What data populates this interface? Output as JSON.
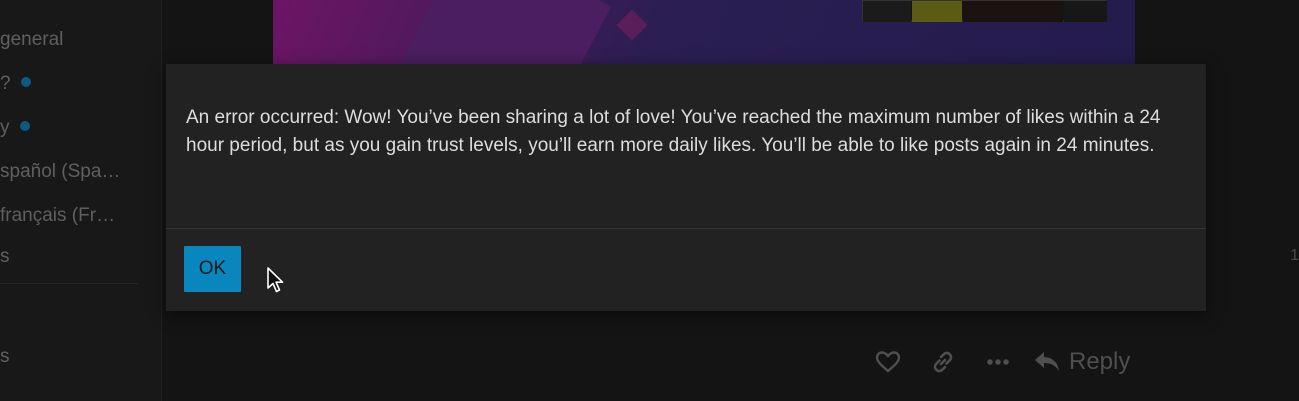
{
  "sidebar": {
    "items": [
      {
        "label": "general",
        "unread": false
      },
      {
        "label": "?",
        "unread": true
      },
      {
        "label": "y",
        "unread": true
      },
      {
        "label": "spañol (Spa…",
        "unread": false
      },
      {
        "label": "français (Fr…",
        "unread": false
      },
      {
        "label": "s",
        "unread": false
      }
    ],
    "bottom_item": "s"
  },
  "edge_digit": "1",
  "post_actions": {
    "like_icon": "heart-icon",
    "link_icon": "link-icon",
    "more_icon": "ellipsis-icon",
    "reply_label": "Reply",
    "reply_icon": "reply-arrow-icon"
  },
  "dialog": {
    "message": "An error occurred: Wow! You’ve been sharing a lot of love! You’ve reached the maximum number of likes within a 24 hour period, but as you gain trust levels, you’ll earn more daily likes. You’ll be able to like posts again in 24 minutes.",
    "ok_label": "OK"
  },
  "colors": {
    "accent": "#0a86be",
    "modal_bg": "#222222",
    "page_bg": "#141414"
  }
}
